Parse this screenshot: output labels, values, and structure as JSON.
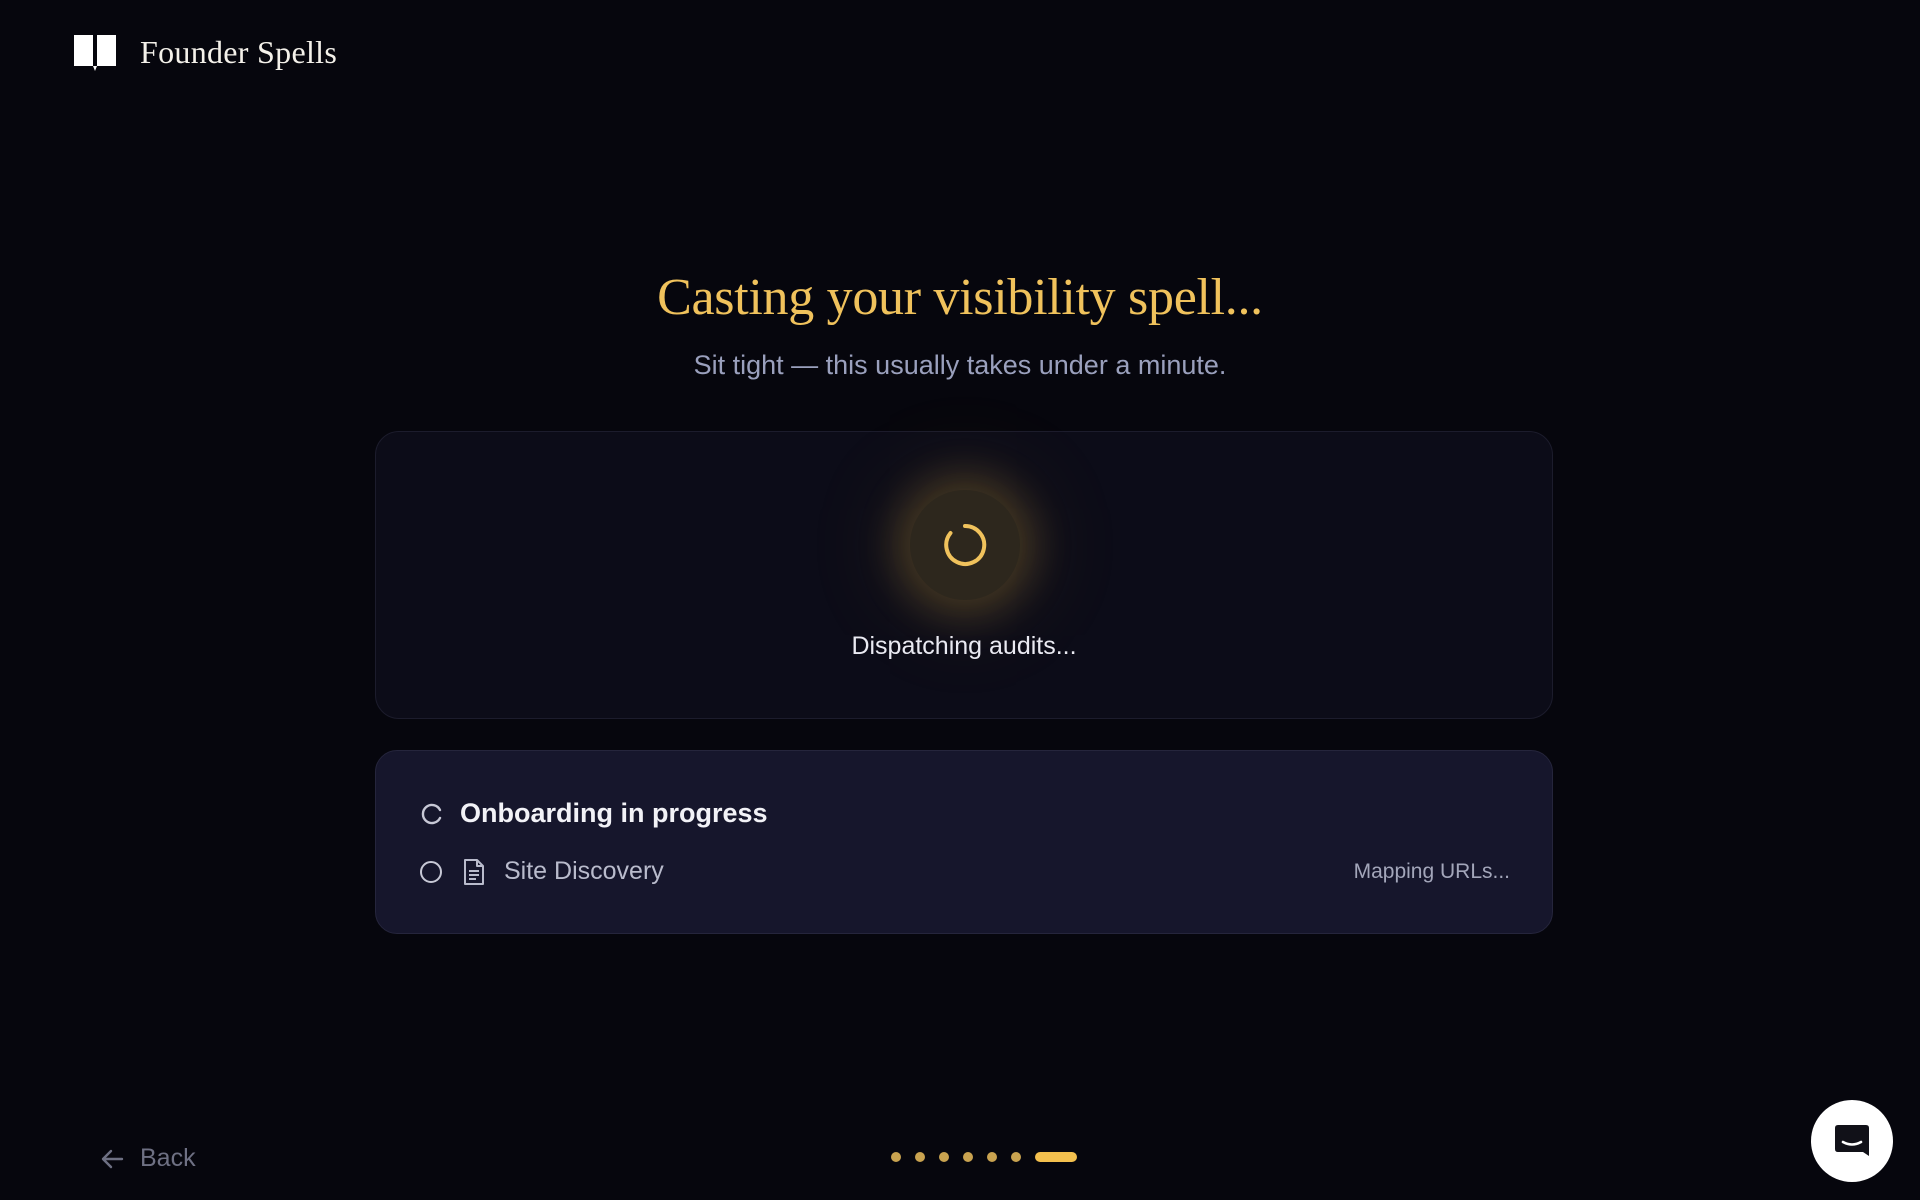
{
  "app": {
    "brand_name": "Founder Spells",
    "logo_icon": "open-book-icon"
  },
  "hero": {
    "title": "Casting your visibility spell...",
    "subtitle": "Sit tight — this usually takes under a minute."
  },
  "status_card": {
    "spinner_icon": "loading-spinner-icon",
    "status_text": "Dispatching audits..."
  },
  "progress_card": {
    "heading": "Onboarding in progress",
    "heading_icon": "loading-arc-icon",
    "steps": [
      {
        "label": "Site Discovery",
        "icon": "document-icon",
        "status_text": "Mapping URLs..."
      }
    ]
  },
  "footer": {
    "back_label": "Back",
    "back_icon": "arrow-left-icon",
    "pager": {
      "total_steps": 7,
      "current_step": 7
    },
    "chat_icon": "chat-icon"
  },
  "colors": {
    "accent": "#f0c25c",
    "background": "#06060d",
    "card": "#0c0c18",
    "card_secondary": "#16162c"
  }
}
